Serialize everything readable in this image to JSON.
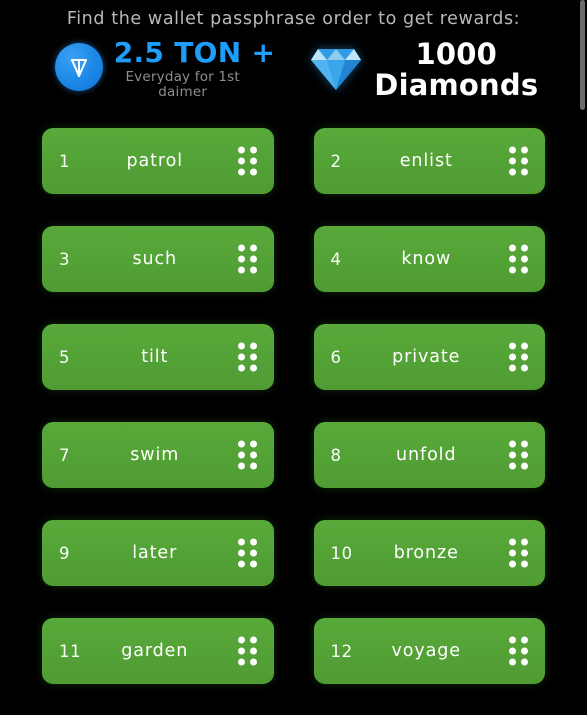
{
  "header": {
    "headline": "Find the wallet passphrase order to get rewards:"
  },
  "rewards": {
    "ton": {
      "icon": "ton-logo-icon",
      "amount": "2.5 TON +",
      "subtitle": "Everyday for 1st daimer",
      "color": "#1f9dfb"
    },
    "diamonds": {
      "icon": "diamond-gem-icon",
      "count": "1000",
      "label": "Diamonds",
      "color": "#ffffff"
    }
  },
  "grid": {
    "accent_color": "#55a538",
    "handle_icon": "drag-handle-icon",
    "tiles": [
      {
        "num": "1",
        "word": "patrol"
      },
      {
        "num": "2",
        "word": "enlist"
      },
      {
        "num": "3",
        "word": "such"
      },
      {
        "num": "4",
        "word": "know"
      },
      {
        "num": "5",
        "word": "tilt"
      },
      {
        "num": "6",
        "word": "private"
      },
      {
        "num": "7",
        "word": "swim"
      },
      {
        "num": "8",
        "word": "unfold"
      },
      {
        "num": "9",
        "word": "later"
      },
      {
        "num": "10",
        "word": "bronze"
      },
      {
        "num": "11",
        "word": "garden"
      },
      {
        "num": "12",
        "word": "voyage"
      }
    ]
  },
  "scrollbar": {
    "thumb_color": "#6b6b6b"
  }
}
